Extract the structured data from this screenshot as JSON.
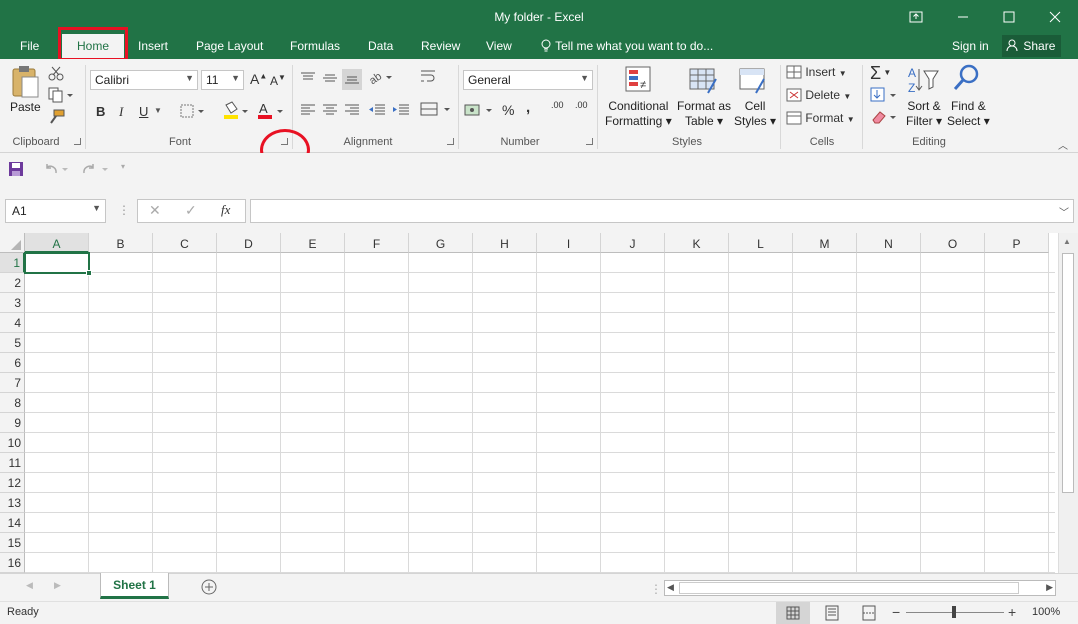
{
  "window": {
    "title": "My folder - Excel"
  },
  "tabs": [
    "File",
    "Home",
    "Insert",
    "Page Layout",
    "Formulas",
    "Data",
    "Review",
    "View"
  ],
  "tell_me": "Tell me what you want to do...",
  "sign_in": "Sign in",
  "share": "Share",
  "ribbon": {
    "clipboard": {
      "paste": "Paste",
      "label": "Clipboard"
    },
    "font": {
      "name": "Calibri",
      "size": "11",
      "label": "Font",
      "bold": "B",
      "italic": "I",
      "underline": "U",
      "grow": "A",
      "shrink": "A",
      "font_color": "A"
    },
    "alignment": {
      "label": "Alignment"
    },
    "number": {
      "format": "General",
      "label": "Number",
      "percent": "%",
      "comma": ",",
      "inc_dec": ".00",
      "dec_dec": ".00"
    },
    "styles": {
      "label": "Styles",
      "conditional": [
        "Conditional",
        "Formatting"
      ],
      "format_table": [
        "Format as",
        "Table"
      ],
      "cell_styles": [
        "Cell",
        "Styles"
      ]
    },
    "cells": {
      "label": "Cells",
      "insert": "Insert",
      "delete": "Delete",
      "format": "Format"
    },
    "editing": {
      "label": "Editing",
      "sort": [
        "Sort &",
        "Filter"
      ],
      "find": [
        "Find &",
        "Select"
      ]
    }
  },
  "formula_bar": {
    "name_box": "A1",
    "fx": "fx",
    "value": ""
  },
  "columns": [
    "A",
    "B",
    "C",
    "D",
    "E",
    "F",
    "G",
    "H",
    "I",
    "J",
    "K",
    "L",
    "M",
    "N",
    "O",
    "P"
  ],
  "rows": [
    "1",
    "2",
    "3",
    "4",
    "5",
    "6",
    "7",
    "8",
    "9",
    "10",
    "11",
    "12",
    "13",
    "14",
    "15",
    "16"
  ],
  "sheet_tab": "Sheet 1",
  "status": {
    "ready": "Ready",
    "zoom": "100%",
    "zoom_level": 1.0
  },
  "colors": {
    "accent": "#217346",
    "highlight": "#e81123"
  }
}
